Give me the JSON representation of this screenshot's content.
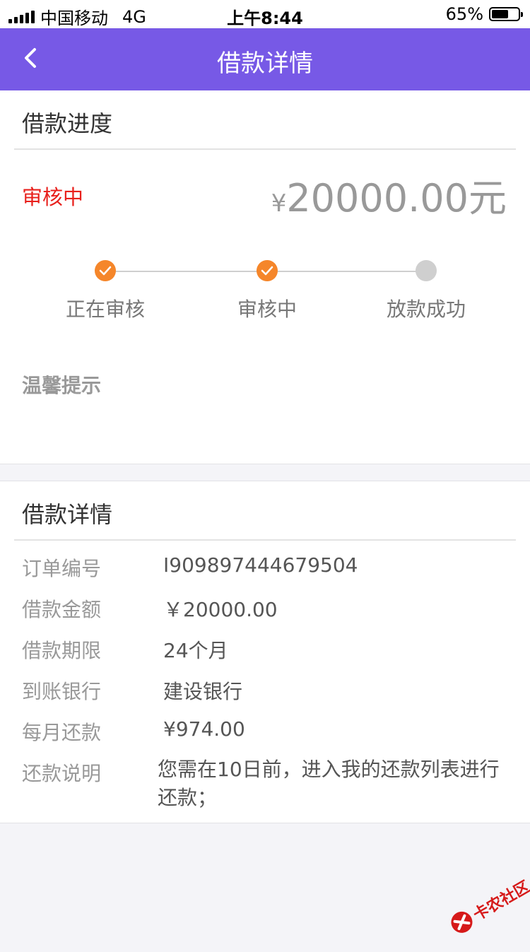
{
  "status_bar": {
    "carrier": "中国移动",
    "network": "4G",
    "time": "上午8:44",
    "battery": "65%",
    "battery_level": 0.65
  },
  "nav": {
    "title": "借款详情",
    "back_icon": "chevron-left-icon",
    "color": "#7759e6"
  },
  "progress": {
    "title": "借款进度",
    "status": "审核中",
    "status_color": "#e8201c",
    "amount_symbol": "¥",
    "amount": "20000.00元",
    "steps": [
      {
        "label": "正在审核",
        "state": "done"
      },
      {
        "label": "审核中",
        "state": "done"
      },
      {
        "label": "放款成功",
        "state": "pending"
      }
    ],
    "step_done_color": "#f5862a",
    "tip_title": "温馨提示"
  },
  "details": {
    "title": "借款详情",
    "rows": [
      {
        "label": "订单编号",
        "value": "I909897444679504"
      },
      {
        "label": "借款金额",
        "value": "￥20000.00"
      },
      {
        "label": "借款期限",
        "value": "24个月"
      },
      {
        "label": "到账银行",
        "value": "建设银行"
      },
      {
        "label": "每月还款",
        "value": "¥974.00"
      },
      {
        "label": "还款说明",
        "value": "您需在10日前，进入我的还款列表进行还款；"
      }
    ]
  },
  "watermark": {
    "text": "卡农社区",
    "icon": "kanong-logo-icon"
  }
}
